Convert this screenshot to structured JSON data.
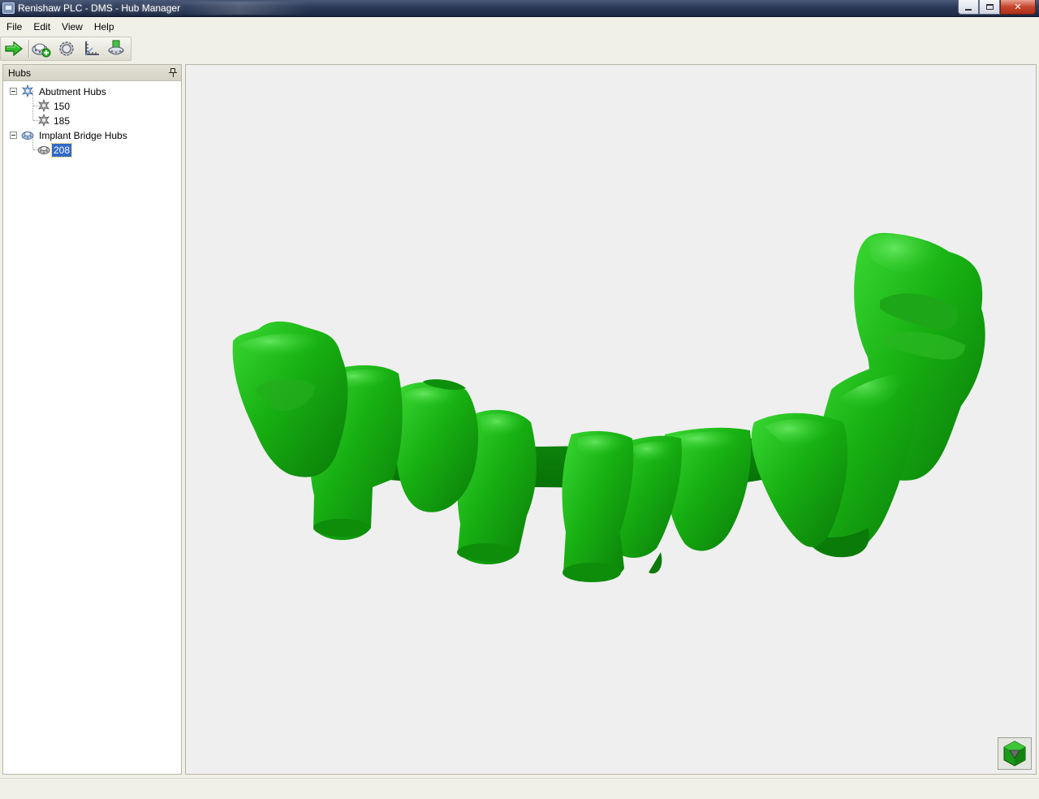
{
  "window": {
    "title": "Renishaw PLC - DMS - Hub Manager",
    "icon": "app-icon"
  },
  "menu": [
    {
      "label": "File"
    },
    {
      "label": "Edit"
    },
    {
      "label": "View"
    },
    {
      "label": "Help"
    }
  ],
  "toolbar": {
    "buttons": [
      {
        "name": "go-arrow-icon"
      },
      {
        "name": "add-hub-icon"
      },
      {
        "name": "hub-gear-icon"
      },
      {
        "name": "axes-icon"
      },
      {
        "name": "hub-cup-icon"
      }
    ]
  },
  "panel": {
    "title": "Hubs",
    "tree": [
      {
        "label": "Abutment Hubs",
        "expanded": true,
        "icon": "abutment-hub-icon",
        "children": [
          {
            "label": "150",
            "icon": "abutment-hub-icon"
          },
          {
            "label": "185",
            "icon": "abutment-hub-icon"
          }
        ]
      },
      {
        "label": "Implant Bridge Hubs",
        "expanded": true,
        "icon": "bridge-hub-icon",
        "children": [
          {
            "label": "208",
            "icon": "bridge-hub-icon",
            "selected": true
          }
        ]
      }
    ]
  },
  "viewport": {
    "model": "dental-bridge-model",
    "model_color": "#1fb51a",
    "nav_cube": "orientation-cube-icon"
  },
  "colors": {
    "selection": "#3169c6",
    "viewport_bg": "#efefef"
  }
}
